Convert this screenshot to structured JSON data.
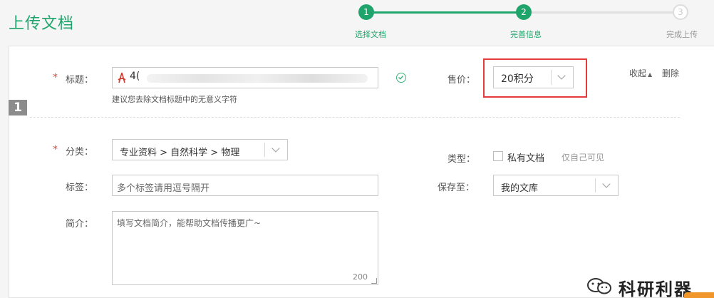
{
  "header": {
    "title": "上传文档",
    "steps": [
      {
        "number": "1",
        "label": "选择文档",
        "state": "done"
      },
      {
        "number": "2",
        "label": "完善信息",
        "state": "current"
      },
      {
        "number": "3",
        "label": "完成上传",
        "state": "todo"
      }
    ]
  },
  "form": {
    "step_badge": "1",
    "title": {
      "required_mark": "*",
      "label": "标题：",
      "value_prefix": "4(",
      "hint": "建议您去除文档标题中的无意义字符"
    },
    "price": {
      "label": "售价：",
      "value": "20积分"
    },
    "actions": {
      "collapse": "收起",
      "delete": "删除"
    },
    "category": {
      "required_mark": "*",
      "label": "分类：",
      "value": "专业资料 > 自然科学 > 物理"
    },
    "type": {
      "label": "类型：",
      "checkbox_label": "私有文档",
      "note": "仅自己可见"
    },
    "tags": {
      "label": "标签：",
      "placeholder": "多个标签请用逗号隔开"
    },
    "save_to": {
      "label": "保存至：",
      "value": "我的文库"
    },
    "intro": {
      "label": "简介：",
      "placeholder": "填写文档简介，能帮助文档传播更广~",
      "char_limit": "200"
    }
  },
  "watermark": {
    "text": "科研利器"
  },
  "colors": {
    "brand_green": "#1fa46b",
    "required_red": "#e24b3b",
    "highlight_red": "#e43a3a",
    "orange": "#f0962a"
  }
}
